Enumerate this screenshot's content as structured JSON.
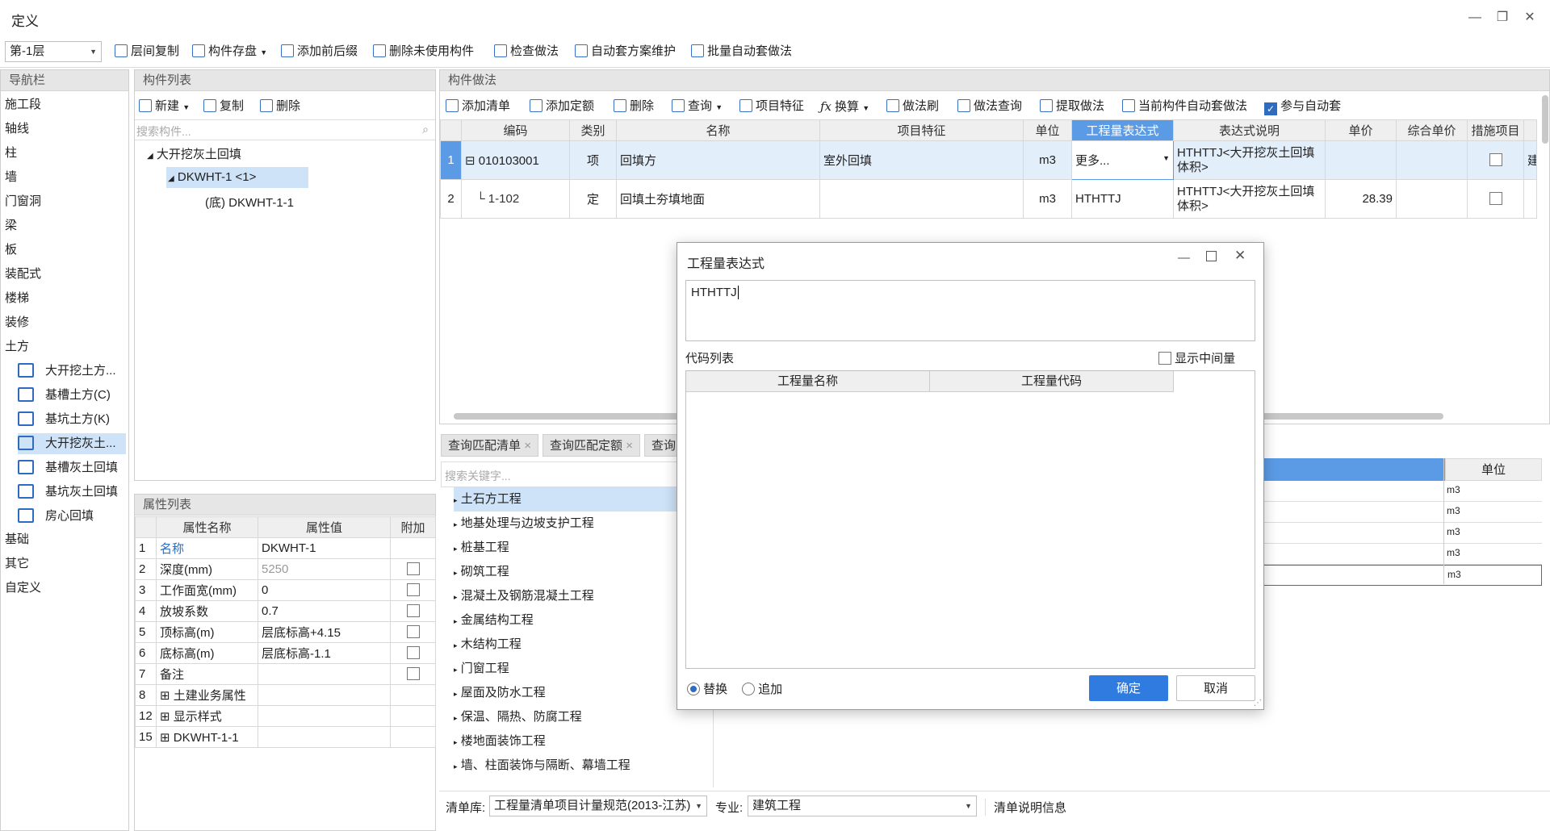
{
  "window": {
    "title": "定义",
    "min": "—",
    "restore": "❐",
    "close": "✕"
  },
  "toolbar": {
    "floor": "第-1层",
    "items": [
      "层间复制",
      "构件存盘",
      "添加前后缀",
      "删除未使用构件",
      "检查做法",
      "自动套方案维护",
      "批量自动套做法"
    ]
  },
  "nav": {
    "title": "导航栏",
    "items": [
      "施工段",
      "轴线",
      "柱",
      "墙",
      "门窗洞",
      "梁",
      "板",
      "装配式",
      "楼梯",
      "装修",
      "土方"
    ],
    "sub": [
      "大开挖土方...",
      "基槽土方(C)",
      "基坑土方(K)",
      "大开挖灰土...",
      "基槽灰土回填",
      "基坑灰土回填",
      "房心回填"
    ],
    "tail": [
      "基础",
      "其它",
      "自定义"
    ]
  },
  "complist": {
    "title": "构件列表",
    "new": "新建",
    "copy": "复制",
    "delete": "删除",
    "search": "搜索构件...",
    "root": "大开挖灰土回填",
    "node": "DKWHT-1 <1>",
    "leaf": "(底) DKWHT-1-1"
  },
  "props": {
    "title": "属性列表",
    "headers": [
      "属性名称",
      "属性值",
      "附加"
    ],
    "rows": [
      {
        "n": "1",
        "name": "名称",
        "val": "DKWHT-1"
      },
      {
        "n": "2",
        "name": "深度(mm)",
        "val": "5250"
      },
      {
        "n": "3",
        "name": "工作面宽(mm)",
        "val": "0"
      },
      {
        "n": "4",
        "name": "放坡系数",
        "val": "0.7"
      },
      {
        "n": "5",
        "name": "顶标高(m)",
        "val": "层底标高+4.15"
      },
      {
        "n": "6",
        "name": "底标高(m)",
        "val": "层底标高-1.1"
      },
      {
        "n": "7",
        "name": "备注",
        "val": ""
      },
      {
        "n": "8",
        "name": "土建业务属性",
        "val": ""
      },
      {
        "n": "12",
        "name": "显示样式",
        "val": ""
      },
      {
        "n": "15",
        "name": "DKWHT-1-1",
        "val": ""
      }
    ]
  },
  "method": {
    "title": "构件做法",
    "toolbar": [
      "添加清单",
      "添加定额",
      "删除",
      "查询",
      "项目特征",
      "换算",
      "做法刷",
      "做法查询",
      "提取做法",
      "当前构件自动套做法",
      "参与自动套"
    ],
    "headers": [
      "编码",
      "类别",
      "名称",
      "项目特征",
      "单位",
      "工程量表达式",
      "表达式说明",
      "单价",
      "综合单价",
      "措施项目"
    ],
    "rows": [
      {
        "n": "1",
        "code": "010103001",
        "type": "项",
        "name": "回填方",
        "feat": "室外回填",
        "unit": "m3",
        "expr": "更多...",
        "desc1": "HTHTTJ<大开挖灰土回填",
        "desc2": "体积>",
        "price": "",
        "extra": "建"
      },
      {
        "n": "2",
        "code": "1-102",
        "type": "定",
        "name": "回填土夯填地面",
        "feat": "",
        "unit": "m3",
        "expr": "HTHTTJ",
        "desc1": "HTHTTJ<大开挖灰土回填",
        "desc2": "体积>",
        "price": "28.39",
        "extra": ""
      }
    ]
  },
  "query": {
    "tabs": [
      "查询匹配清单",
      "查询匹配定额",
      "查询"
    ],
    "search": "搜索关键字...",
    "tree": [
      "土石方工程",
      "地基处理与边坡支护工程",
      "桩基工程",
      "砌筑工程",
      "混凝土及钢筋混凝土工程",
      "金属结构工程",
      "木结构工程",
      "门窗工程",
      "屋面及防水工程",
      "保温、隔热、防腐工程",
      "楼地面装饰工程",
      "墙、柱面装饰与隔断、幕墙工程"
    ],
    "unit_header": "单位",
    "units": [
      "m3",
      "m3",
      "m3",
      "m3",
      "m3"
    ],
    "lib_label": "清单库:",
    "lib_value": "工程量清单项目计量规范(2013-江苏)",
    "spec_label": "专业:",
    "spec_value": "建筑工程",
    "info": "清单说明信息"
  },
  "dialog": {
    "title": "工程量表达式",
    "expr": "HTHTTJ",
    "code_list": "代码列表",
    "show_mid": "显示中间量",
    "headers": [
      "工程量名称",
      "工程量代码"
    ],
    "replace": "替换",
    "append": "追加",
    "ok": "确定",
    "cancel": "取消"
  }
}
